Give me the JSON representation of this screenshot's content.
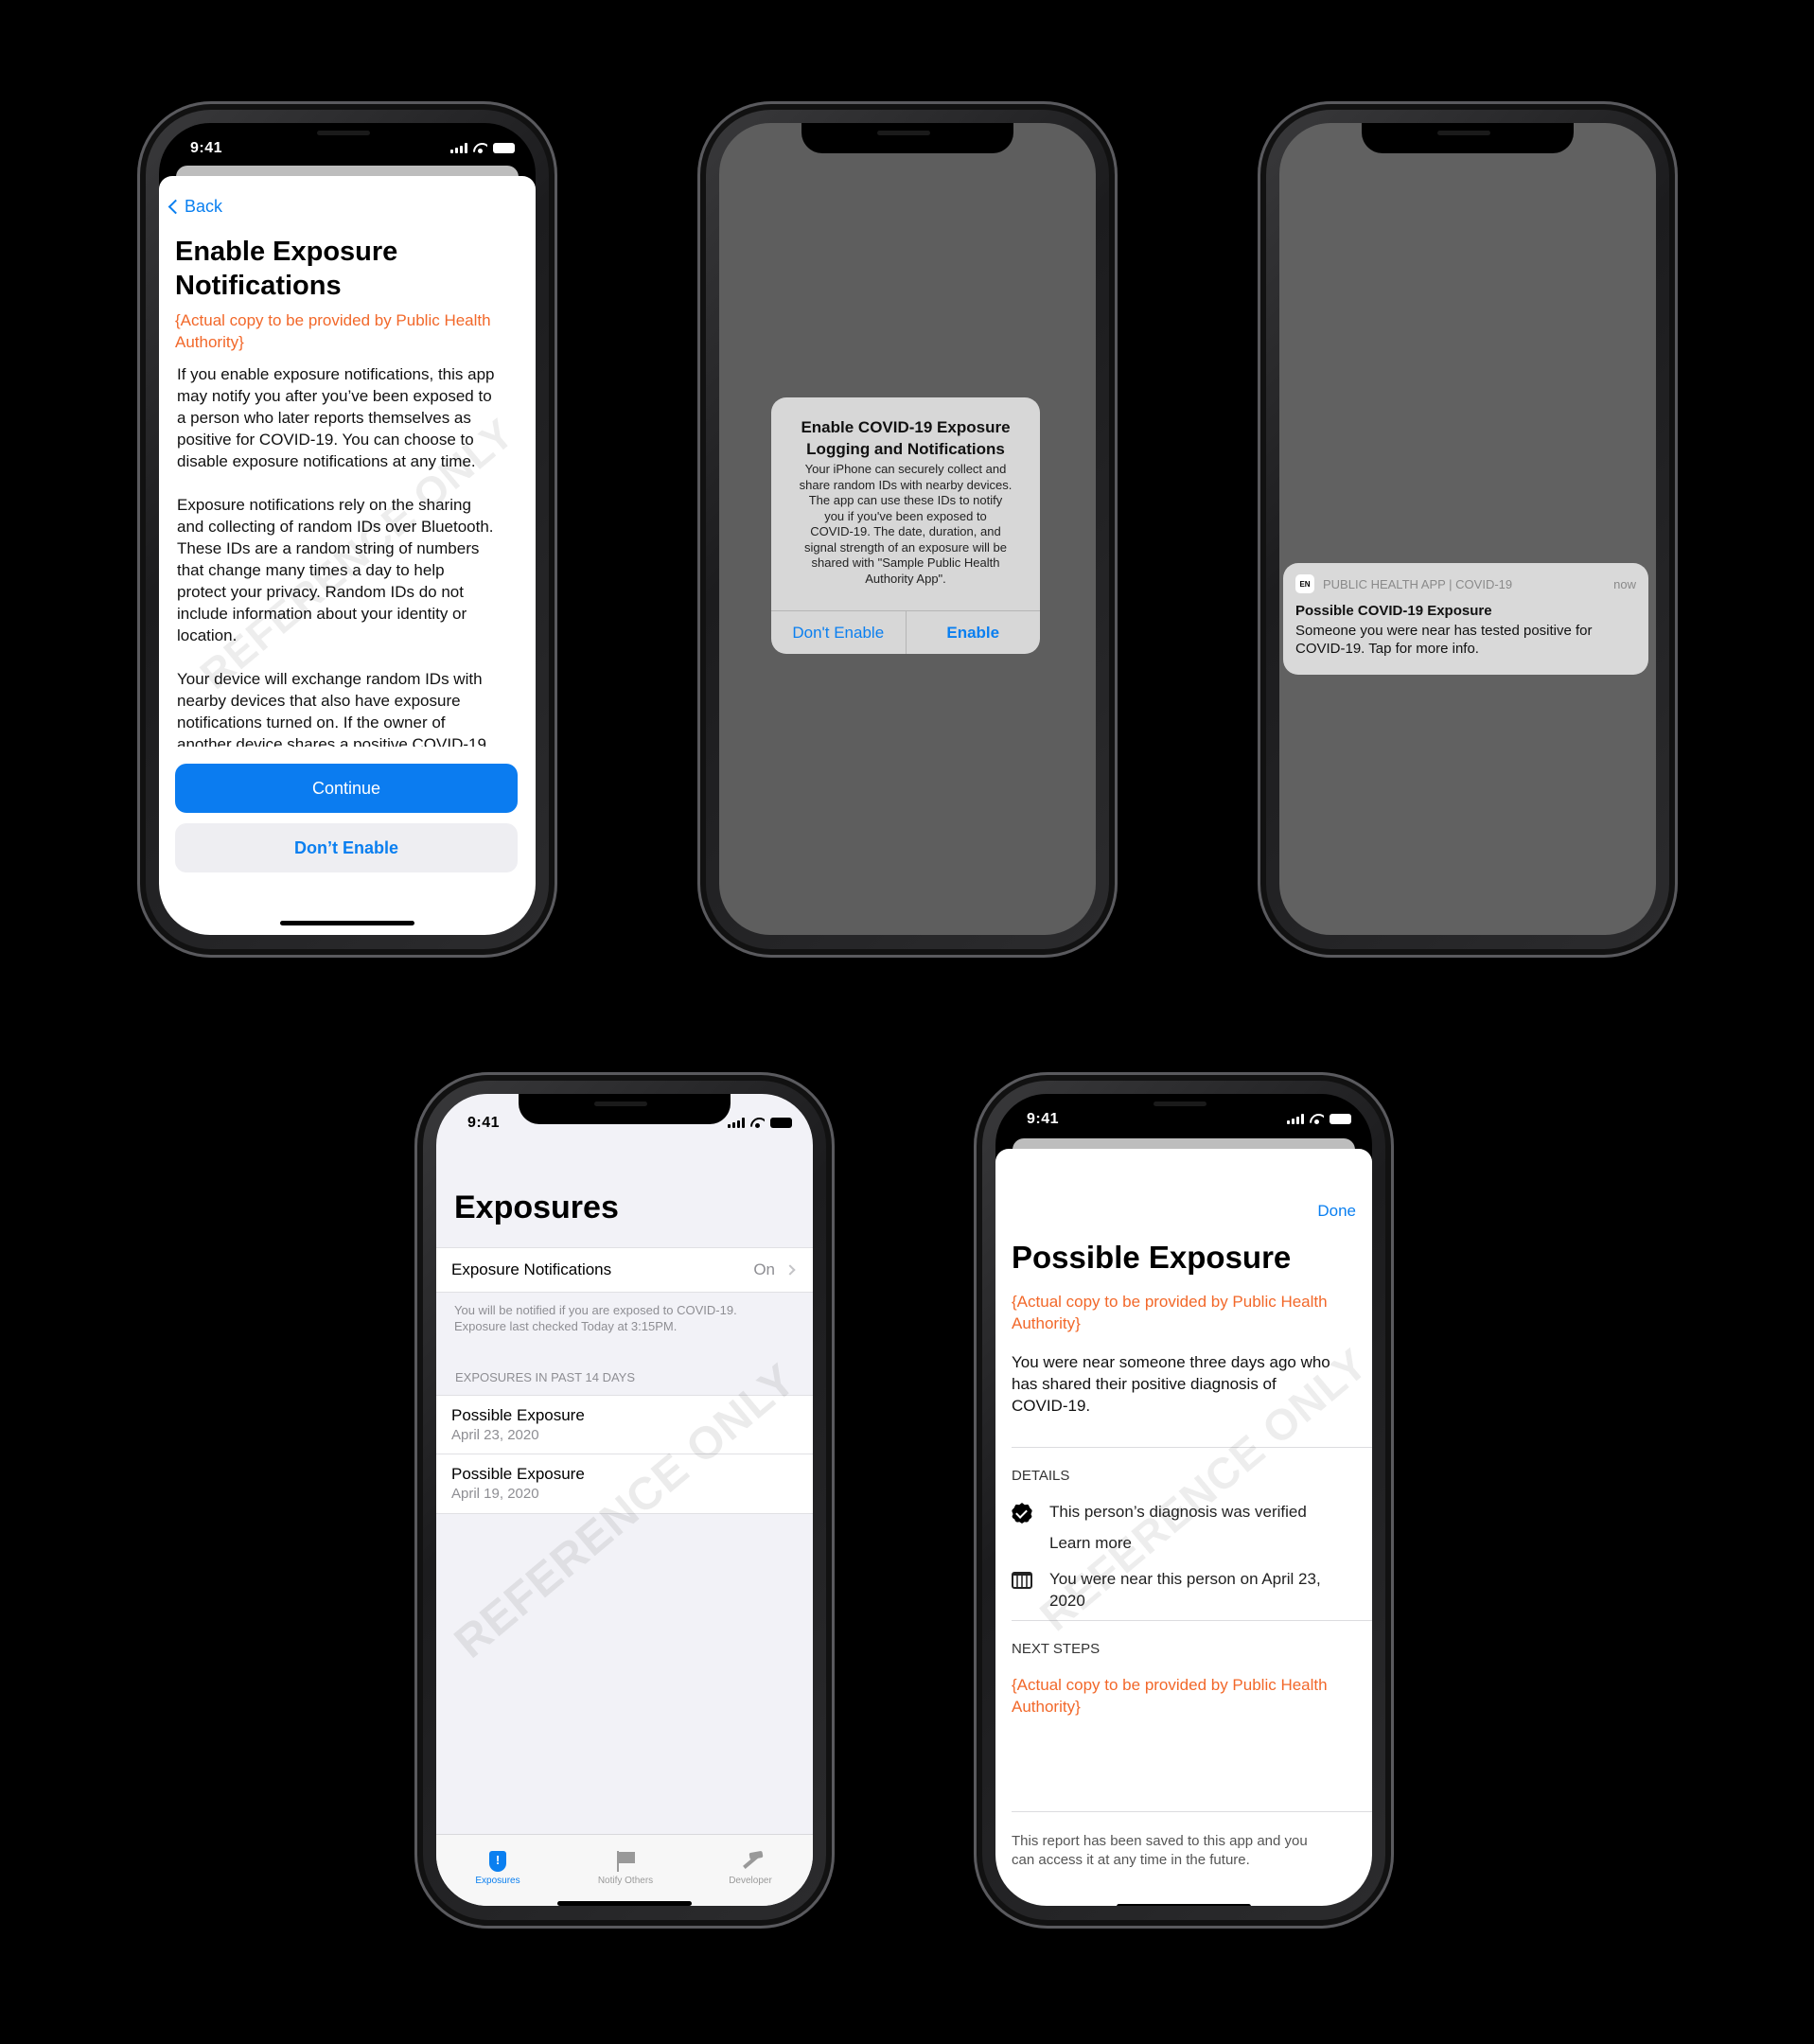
{
  "status_time": "9:41",
  "watermark": "REFERENCE ONLY",
  "colors": {
    "accent_blue": "#0a7ff0",
    "placeholder_orange": "#f2682a",
    "alert_gray": "#d7d7d7"
  },
  "onboarding": {
    "back_label": "Back",
    "title": "Enable Exposure\nNotifications",
    "placeholder_copy": "{Actual copy to be provided by Public Health\nAuthority}",
    "body": "If you enable exposure notifications, this app\nmay notify you after you’ve been exposed to\na person who later reports themselves as\npositive for COVID-19. You can choose to\ndisable exposure notifications at any time.\n\nExposure notifications rely on the sharing\nand collecting of random IDs over Bluetooth.\nThese IDs are a random string of numbers\nthat change many times a day to help\nprotect your privacy.  Random IDs do not\ninclude information about your identity or\nlocation.\n\nYour device will exchange random IDs with\nnearby devices that also have exposure\nnotifications turned on. If the owner of\nanother device shares a positive COVID-19",
    "continue_label": "Continue",
    "dont_enable_label": "Don’t Enable"
  },
  "system_alert": {
    "title": "Enable COVID-19 Exposure\nLogging and Notifications",
    "message": "Your iPhone can securely collect and\nshare random IDs with nearby devices.\nThe app can use these IDs to notify\nyou if you've been exposed to\nCOVID-19. The date, duration, and\nsignal strength of an exposure will be\nshared with \"Sample Public Health\nAuthority App\".",
    "dont_enable_label": "Don't Enable",
    "enable_label": "Enable"
  },
  "notification": {
    "app_icon_text": "EN",
    "app_name": "PUBLIC HEALTH APP | COVID-19",
    "time": "now",
    "title": "Possible COVID-19 Exposure",
    "body": "Someone you were near has tested positive for\nCOVID-19. Tap for more info."
  },
  "exposures": {
    "title": "Exposures",
    "setting_label": "Exposure Notifications",
    "setting_value": "On",
    "footer": "You will be notified if you are exposed to COVID-19.\nExposure last checked Today at 3:15PM.",
    "section_header": "EXPOSURES IN PAST 14 DAYS",
    "items": [
      {
        "title": "Possible Exposure",
        "date": "April 23, 2020"
      },
      {
        "title": "Possible Exposure",
        "date": "April 19, 2020"
      }
    ],
    "tabs": [
      {
        "label": "Exposures",
        "icon": "shield-exclamation-icon",
        "active": true
      },
      {
        "label": "Notify Others",
        "icon": "flag-icon",
        "active": false
      },
      {
        "label": "Developer",
        "icon": "hammer-icon",
        "active": false
      }
    ]
  },
  "detail": {
    "done_label": "Done",
    "title": "Possible Exposure",
    "placeholder_copy": "{Actual copy to be provided by Public Health\nAuthority}",
    "body": "You were near someone three days ago who\nhas shared their positive diagnosis of\nCOVID-19.",
    "details_header": "DETAILS",
    "verified_text": "This person’s diagnosis was verified",
    "learn_more": "Learn more",
    "date_text": "You were near this person on April 23,\n2020",
    "next_steps_header": "NEXT STEPS",
    "next_steps_copy": "{Actual copy to be provided by Public Health\nAuthority}",
    "footer": "This report has been saved to this app and you\ncan access it at any time in the future."
  }
}
